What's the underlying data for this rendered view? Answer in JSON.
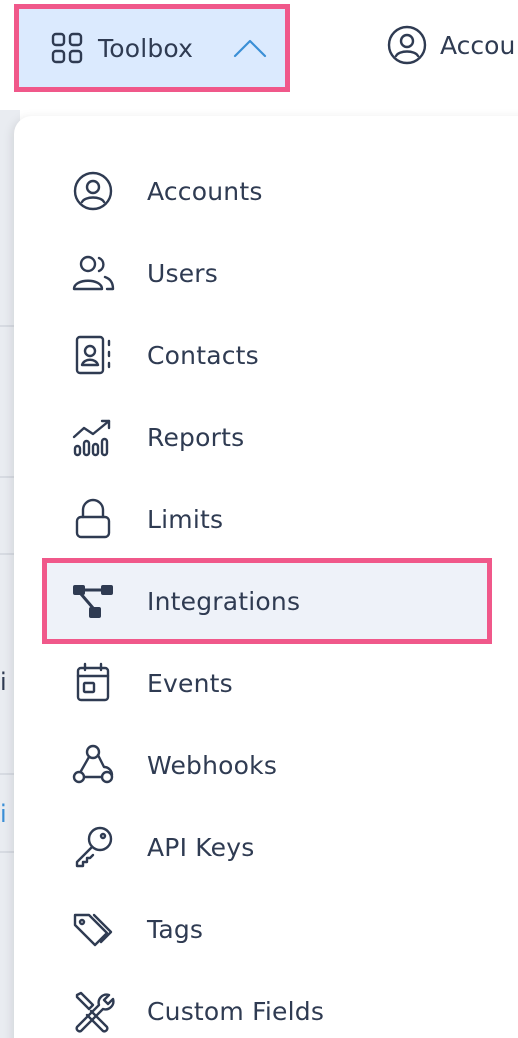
{
  "topbar": {
    "toolbox_label": "Toolbox",
    "accounts_label": "Accou",
    "highlight_color": "#f0588a",
    "active_bg": "#dbeafe"
  },
  "background": {
    "fragments": [
      "i",
      "i"
    ]
  },
  "menu": {
    "items": [
      {
        "label": "Accounts",
        "icon": "user-circle-icon"
      },
      {
        "label": "Users",
        "icon": "users-icon"
      },
      {
        "label": "Contacts",
        "icon": "contact-book-icon"
      },
      {
        "label": "Reports",
        "icon": "bar-chart-trend-icon"
      },
      {
        "label": "Limits",
        "icon": "lock-icon"
      },
      {
        "label": "Integrations",
        "icon": "hierarchy-nodes-icon",
        "highlighted": true
      },
      {
        "label": "Events",
        "icon": "calendar-icon"
      },
      {
        "label": "Webhooks",
        "icon": "webhook-icon"
      },
      {
        "label": "API Keys",
        "icon": "key-icon"
      },
      {
        "label": "Tags",
        "icon": "tags-icon"
      },
      {
        "label": "Custom Fields",
        "icon": "tools-icon"
      }
    ]
  }
}
